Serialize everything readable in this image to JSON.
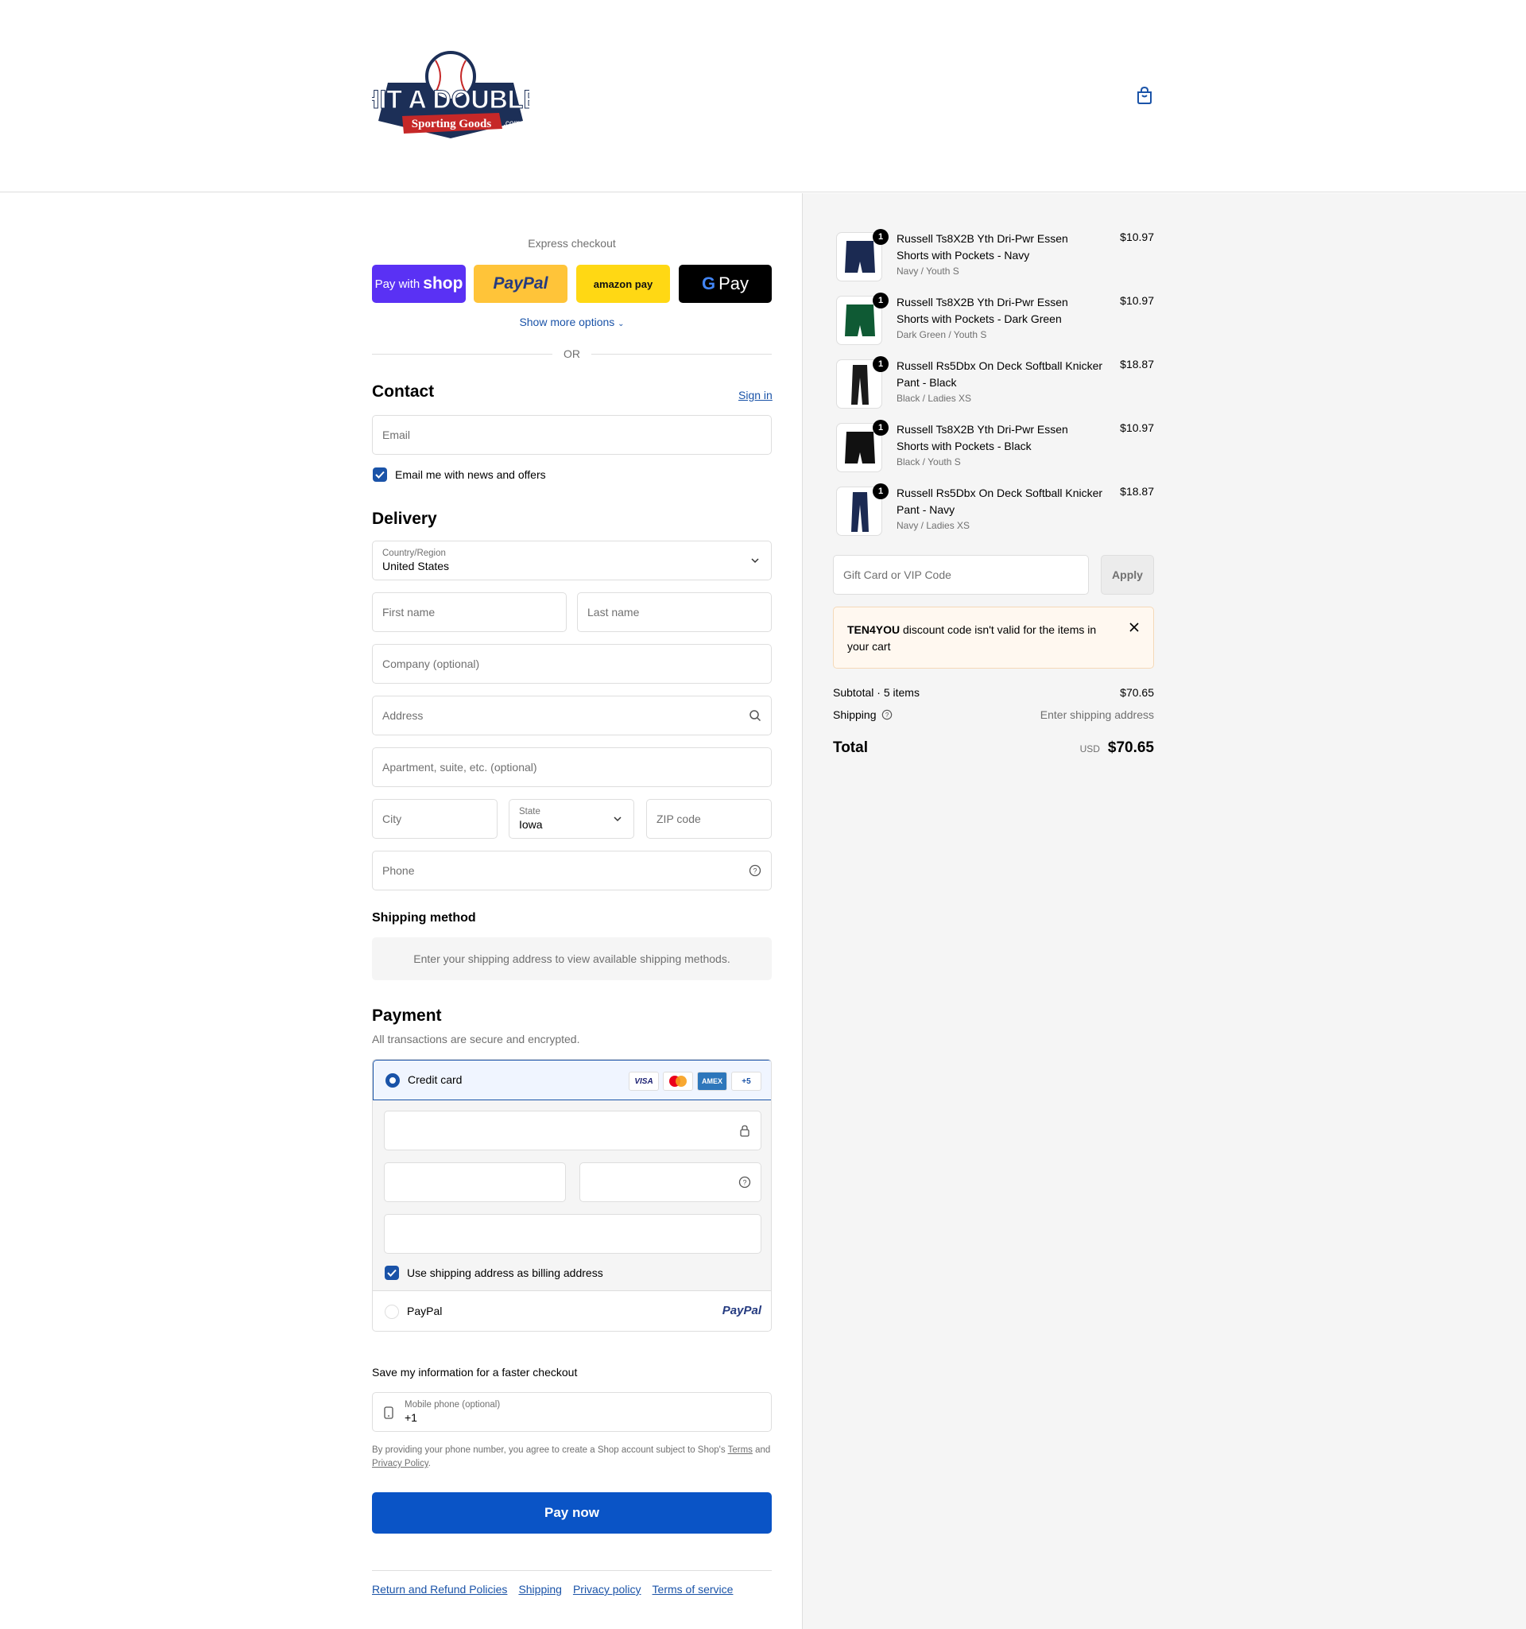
{
  "brand": {
    "logo_top": "HIT A DOUBLE",
    "logo_bottom": "Sporting Goods",
    "logo_com": ".com",
    "accent": "#1a53a8"
  },
  "express": {
    "label": "Express checkout",
    "shop_pay_prefix": "Pay with",
    "shop_pay_brand": "shop",
    "paypal": "PayPal",
    "amazon": "amazon pay",
    "gpay": "Pay",
    "show_more": "Show more options"
  },
  "or_label": "OR",
  "contact": {
    "title": "Contact",
    "sign_in": "Sign in",
    "email_placeholder": "Email",
    "news_label": "Email me with news and offers"
  },
  "delivery": {
    "title": "Delivery",
    "country_label": "Country/Region",
    "country_value": "United States",
    "first_name": "First name",
    "last_name": "Last name",
    "company": "Company (optional)",
    "address": "Address",
    "apartment": "Apartment, suite, etc. (optional)",
    "city": "City",
    "state_label": "State",
    "state_value": "Iowa",
    "zip": "ZIP code",
    "phone": "Phone"
  },
  "shipping_method": {
    "title": "Shipping method",
    "message": "Enter your shipping address to view available shipping methods."
  },
  "payment": {
    "title": "Payment",
    "subtitle": "All transactions are secure and encrypted.",
    "credit_card": "Credit card",
    "cards": [
      "VISA",
      "",
      "AMEX",
      "+5"
    ],
    "billing_label": "Use shipping address as billing address",
    "paypal": "PayPal",
    "paypal_logo": "PayPal"
  },
  "save_info": {
    "title": "Save my information for a faster checkout",
    "mobile_label": "Mobile phone (optional)",
    "mobile_value": "+1",
    "disclaimer_a": "By providing your phone number, you agree to create a Shop account subject to Shop's",
    "terms": "Terms",
    "and": "and",
    "privacy": "Privacy Policy",
    "period": "."
  },
  "pay_now": "Pay now",
  "footer": [
    "Return and Refund Policies",
    "Shipping",
    "Privacy policy",
    "Terms of service"
  ],
  "cart": {
    "items": [
      {
        "qty": "1",
        "name": "Russell Ts8X2B Yth Dri-Pwr Essen Shorts with Pockets - Navy",
        "variant": "Navy / Youth S",
        "price": "$10.97",
        "color": "#1b2a52"
      },
      {
        "qty": "1",
        "name": "Russell Ts8X2B Yth Dri-Pwr Essen Shorts with Pockets - Dark Green",
        "variant": "Dark Green / Youth S",
        "price": "$10.97",
        "color": "#0f5a34"
      },
      {
        "qty": "1",
        "name": "Russell Rs5Dbx On Deck Softball Knicker Pant - Black",
        "variant": "Black / Ladies XS",
        "price": "$18.87",
        "color": "#1a1a1a"
      },
      {
        "qty": "1",
        "name": "Russell Ts8X2B Yth Dri-Pwr Essen Shorts with Pockets - Black",
        "variant": "Black / Youth S",
        "price": "$10.97",
        "color": "#111111"
      },
      {
        "qty": "1",
        "name": "Russell Rs5Dbx On Deck Softball Knicker Pant - Navy",
        "variant": "Navy / Ladies XS",
        "price": "$18.87",
        "color": "#1b2a52"
      }
    ],
    "gift_placeholder": "Gift Card or VIP Code",
    "apply": "Apply",
    "alert_code": "TEN4YOU",
    "alert_text": " discount code isn't valid for the items in your cart",
    "subtotal_label": "Subtotal · 5 items",
    "subtotal_value": "$70.65",
    "shipping_label": "Shipping",
    "shipping_value": "Enter shipping address",
    "total_label": "Total",
    "currency": "USD",
    "total_value": "$70.65"
  }
}
